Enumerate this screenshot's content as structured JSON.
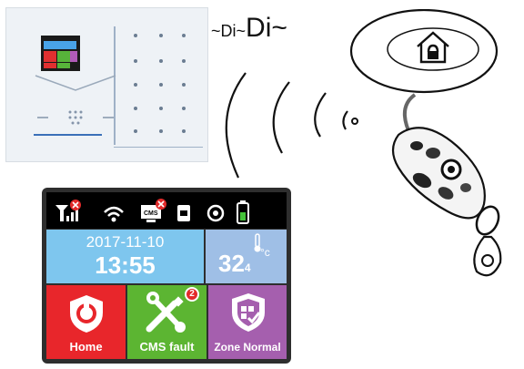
{
  "sound": {
    "di_small": "~Di~",
    "di_large": "Di~",
    "tilde": "~"
  },
  "screen": {
    "date": "2017-11-10",
    "time": "13:55",
    "temperature": "32",
    "temperature_sub": "4",
    "temperature_unit": "°c",
    "status_icons": [
      "signal-off-icon",
      "wifi-icon",
      "cms-off-icon",
      "sim-icon",
      "clock-icon",
      "battery-icon"
    ],
    "tiles": [
      {
        "label": "Home",
        "icon": "home-shield-icon",
        "color": "#e8262b"
      },
      {
        "label": "CMS fault",
        "icon": "tools-icon",
        "color": "#5cb532",
        "badge": "2"
      },
      {
        "label": "Zone Normal",
        "icon": "zone-shield-icon",
        "color": "#a55fae"
      }
    ],
    "colors": {
      "date_tile": "#7ec6ee",
      "temp_tile": "#9fbfe6",
      "status_bar": "#000000"
    }
  },
  "remote": {
    "bubble_icon": "house-lock-icon"
  }
}
